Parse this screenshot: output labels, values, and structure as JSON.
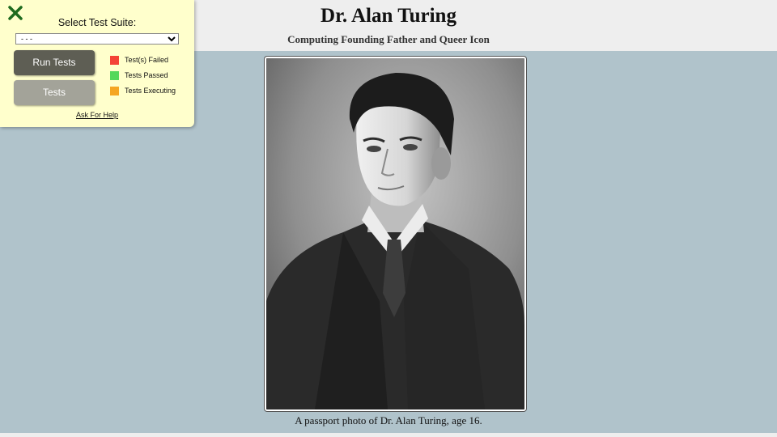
{
  "header": {
    "title": "Dr. Alan Turing",
    "subtitle": "Computing Founding Father and Queer Icon"
  },
  "figure": {
    "caption": "A passport photo of Dr. Alan Turing, age 16."
  },
  "test_panel": {
    "close_icon": "close-x-icon",
    "heading": "Select Test Suite:",
    "suite_select": {
      "selected": "- - -"
    },
    "run_button": "Run Tests",
    "tests_button": "Tests",
    "legend": [
      {
        "label": "Test(s) Failed",
        "color": "#f44336"
      },
      {
        "label": "Tests Passed",
        "color": "#55d85a"
      },
      {
        "label": "Tests Executing",
        "color": "#f5a623"
      }
    ],
    "help_link": "Ask For Help"
  },
  "colors": {
    "page_background": "#b0c3cb",
    "header_background": "#eeeeee",
    "panel_background": "#ffffcc"
  }
}
